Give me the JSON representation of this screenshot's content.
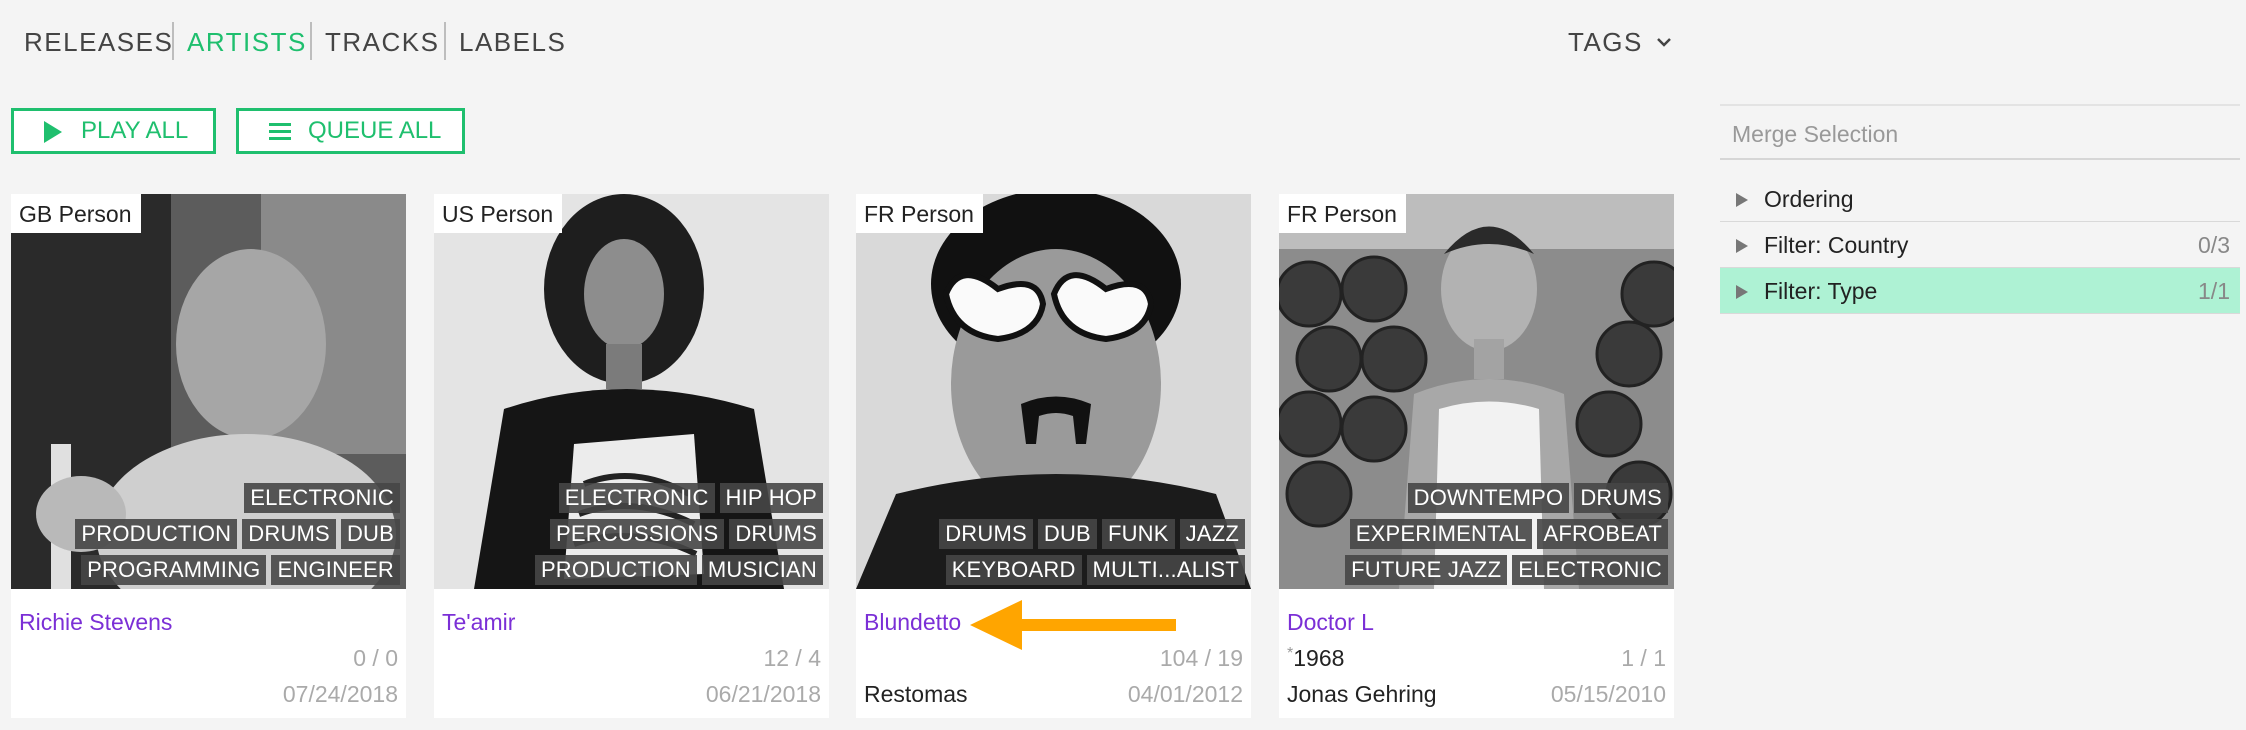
{
  "nav": {
    "tabs": [
      {
        "label": "RELEASES"
      },
      {
        "label": "ARTISTS"
      },
      {
        "label": "TRACKS"
      },
      {
        "label": "LABELS"
      }
    ],
    "tags_label": "TAGS"
  },
  "actions": {
    "play_all": "PLAY ALL",
    "queue_all": "QUEUE ALL"
  },
  "colors": {
    "accent": "#1fbf6e",
    "link": "#7b2fd6",
    "highlight_row": "#aef2d4",
    "annotation_arrow": "#ffa500"
  },
  "cards": [
    {
      "country": "GB Person",
      "name": "Richie Stevens",
      "genres": [
        "DRUMS",
        "DUB",
        "ELECTRONIC",
        "ENGINEER",
        "PRODUCTION",
        "PROGRAMMING"
      ],
      "counts": "0 / 0",
      "date": "07/24/2018",
      "born": "",
      "extra": ""
    },
    {
      "country": "US Person",
      "name": "Te'amir",
      "genres": [
        "DRUMS",
        "ELECTRONIC",
        "HIP HOP",
        "MUSICIAN",
        "PERCUSSIONS",
        "PRODUCTION"
      ],
      "counts": "12 / 4",
      "date": "06/21/2018",
      "born": "",
      "extra": ""
    },
    {
      "country": "FR Person",
      "name": "Blundetto",
      "genres": [
        "DRUMS",
        "DUB",
        "FUNK",
        "JAZZ",
        "KEYBOARD",
        "MULTI...ALIST"
      ],
      "counts": "104 / 19",
      "date": "04/01/2012",
      "born": "",
      "extra": "Restomas"
    },
    {
      "country": "FR Person",
      "name": "Doctor L",
      "genres": [
        "AFROBEAT",
        "DOWNTEMPO",
        "DRUMS",
        "ELECTRONIC",
        "EXPERIMENTAL",
        "FUTURE JAZZ"
      ],
      "counts": "1 / 1",
      "date": "05/15/2010",
      "born_star": "*",
      "born": "1968",
      "extra": "Jonas Gehring"
    }
  ],
  "sidebar": {
    "merge_placeholder": "Merge Selection",
    "filters": [
      {
        "label": "Ordering",
        "count": ""
      },
      {
        "label": "Filter: Country",
        "count": "0/3"
      },
      {
        "label": "Filter: Type",
        "count": "1/1"
      }
    ]
  }
}
